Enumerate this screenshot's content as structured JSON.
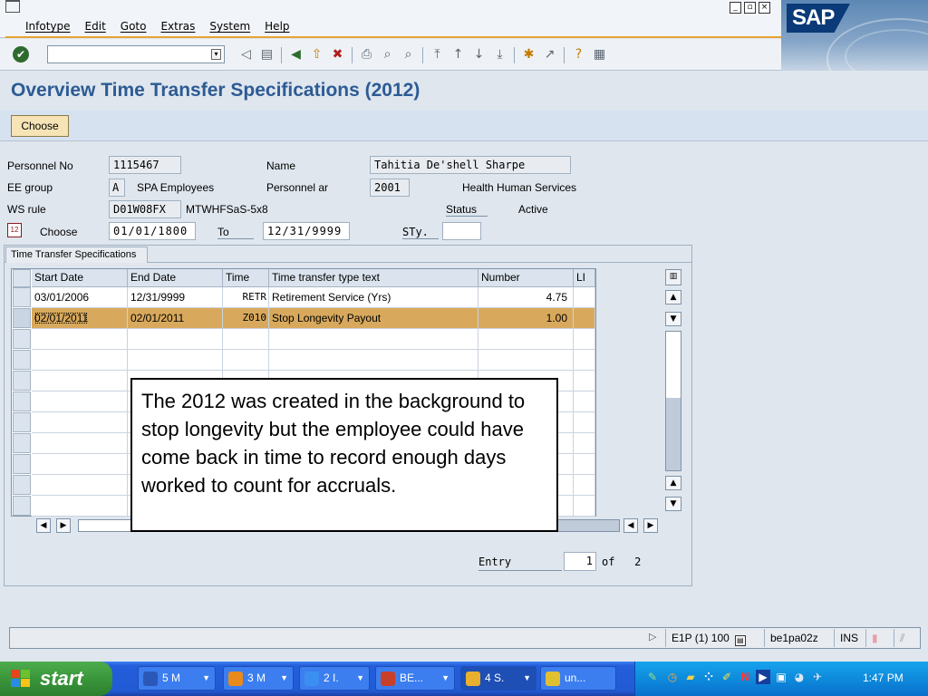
{
  "menu": {
    "items": [
      "Infotype",
      "Edit",
      "Goto",
      "Extras",
      "System",
      "Help"
    ]
  },
  "branding": {
    "logo_text": "SAP"
  },
  "toolbar": {
    "command_field_value": "",
    "icons": [
      "enter-icon",
      "back-icon",
      "save-icon",
      "back-green-icon",
      "exit-icon",
      "cancel-icon",
      "print-icon",
      "find-icon",
      "find-next-icon",
      "first-page-icon",
      "previous-page-icon",
      "next-page-icon",
      "last-page-icon",
      "create-session-icon",
      "shortcut-icon",
      "help-icon",
      "layout-icon"
    ]
  },
  "page": {
    "title": "Overview Time Transfer Specifications (2012)",
    "choose_button": "Choose"
  },
  "header": {
    "personnel_no_label": "Personnel No",
    "personnel_no": "1115467",
    "name_label": "Name",
    "name": "Tahitia De'shell Sharpe",
    "ee_group_label": "EE group",
    "ee_group_code": "A",
    "ee_group_text": "SPA Employees",
    "personnel_area_label": "Personnel ar",
    "personnel_area_code": "2001",
    "personnel_area_text": "Health Human Services",
    "ws_rule_label": "WS rule",
    "ws_rule_code": "D01W08FX",
    "ws_rule_text": "MTWHFSaS-5x8",
    "status_label": "Status",
    "status_value": "Active",
    "choose_label": "Choose",
    "from_date": "01/01/1800",
    "to_label": "To",
    "to_date": "12/31/9999",
    "sty_label": "STy.",
    "sty_value": ""
  },
  "tab": {
    "label": "Time Transfer Specifications"
  },
  "table": {
    "columns": [
      "Start Date",
      "End Date",
      "Time",
      "Time transfer type text",
      "Number",
      "LI"
    ],
    "rows": [
      {
        "start": "03/01/2006",
        "end": "12/31/9999",
        "time": "RETR",
        "text": "Retirement Service (Yrs)",
        "number": "4.75",
        "li": ""
      },
      {
        "start": "02/01/2011",
        "end": "02/01/2011",
        "time": "Z010",
        "text": "Stop Longevity Payout",
        "number": "1.00",
        "li": ""
      }
    ]
  },
  "entry": {
    "label": "Entry",
    "current": "1",
    "of_text": "of   2"
  },
  "annotation": {
    "text": "The 2012 was created in the background to stop longevity but the employee could have come back in time to record enough days worked to count for accruals."
  },
  "statusbar": {
    "system": "E1P (1) 100",
    "server": "be1pa02z",
    "mode": "INS"
  },
  "taskbar": {
    "start_label": "start",
    "tasks": [
      {
        "label": "5 M",
        "icon": "word-icon",
        "color": "#2b58b8"
      },
      {
        "label": "3 M",
        "icon": "outlook-icon",
        "color": "#e98a1c"
      },
      {
        "label": "2 I.",
        "icon": "ie-icon",
        "color": "#3b8ff0"
      },
      {
        "label": "BE...",
        "icon": "document-icon",
        "color": "#c8402a"
      },
      {
        "label": "4 S.",
        "icon": "folder-icon",
        "color": "#e9b030"
      },
      {
        "label": "un...",
        "icon": "paint-icon",
        "color": "#e0c030"
      }
    ],
    "clock": "1:47 PM"
  }
}
